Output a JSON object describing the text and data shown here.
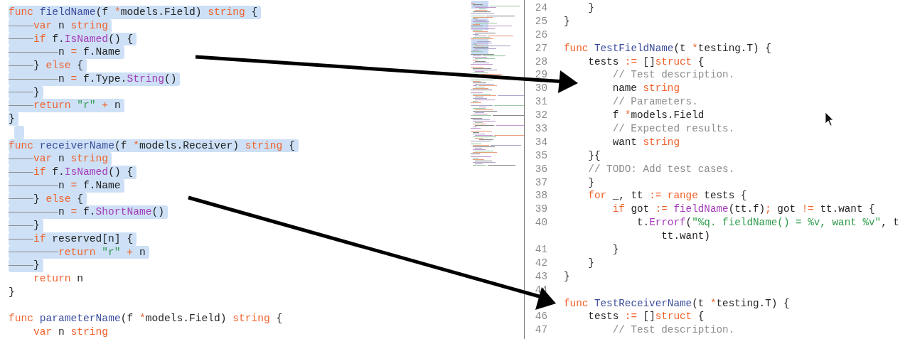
{
  "left_editor": {
    "lines": [
      {
        "selected": true,
        "tokens": [
          {
            "kind": "keyword",
            "text": "func "
          },
          {
            "kind": "decl",
            "text": "fieldName"
          },
          {
            "kind": "plain",
            "text": "(f "
          },
          {
            "kind": "keyword",
            "text": "*"
          },
          {
            "kind": "plain",
            "text": "models.Field) "
          },
          {
            "kind": "keyword",
            "text": "string"
          },
          {
            "kind": "plain",
            "text": " {"
          }
        ]
      },
      {
        "selected": true,
        "tokens": [
          {
            "kind": "keyword",
            "text": "\tvar"
          },
          {
            "kind": "plain",
            "text": " n "
          },
          {
            "kind": "keyword",
            "text": "string"
          }
        ]
      },
      {
        "selected": true,
        "tokens": [
          {
            "kind": "keyword",
            "text": "\tif"
          },
          {
            "kind": "plain",
            "text": " f."
          },
          {
            "kind": "call",
            "text": "IsNamed"
          },
          {
            "kind": "plain",
            "text": "() {"
          }
        ]
      },
      {
        "selected": true,
        "tokens": [
          {
            "kind": "plain",
            "text": "\t\tn "
          },
          {
            "kind": "keyword",
            "text": "="
          },
          {
            "kind": "plain",
            "text": " f.Name"
          }
        ]
      },
      {
        "selected": true,
        "tokens": [
          {
            "kind": "plain",
            "text": "\t} "
          },
          {
            "kind": "keyword",
            "text": "else"
          },
          {
            "kind": "plain",
            "text": " {"
          }
        ]
      },
      {
        "selected": true,
        "tokens": [
          {
            "kind": "plain",
            "text": "\t\tn "
          },
          {
            "kind": "keyword",
            "text": "="
          },
          {
            "kind": "plain",
            "text": " f.Type."
          },
          {
            "kind": "call",
            "text": "String"
          },
          {
            "kind": "plain",
            "text": "()"
          }
        ]
      },
      {
        "selected": true,
        "tokens": [
          {
            "kind": "plain",
            "text": "\t}"
          }
        ]
      },
      {
        "selected": true,
        "tokens": [
          {
            "kind": "keyword",
            "text": "\treturn"
          },
          {
            "kind": "string",
            "text": " \"r\""
          },
          {
            "kind": "keyword",
            "text": " + "
          },
          {
            "kind": "plain",
            "text": "n"
          }
        ]
      },
      {
        "selected": true,
        "tokens": [
          {
            "kind": "plain",
            "text": "}"
          }
        ]
      },
      {
        "selected": true
      },
      {
        "selected": true,
        "tokens": [
          {
            "kind": "keyword",
            "text": "func "
          },
          {
            "kind": "decl",
            "text": "receiverName"
          },
          {
            "kind": "plain",
            "text": "(f "
          },
          {
            "kind": "keyword",
            "text": "*"
          },
          {
            "kind": "plain",
            "text": "models.Receiver) "
          },
          {
            "kind": "keyword",
            "text": "string"
          },
          {
            "kind": "plain",
            "text": " {"
          }
        ]
      },
      {
        "selected": true,
        "tokens": [
          {
            "kind": "keyword",
            "text": "\tvar"
          },
          {
            "kind": "plain",
            "text": " n "
          },
          {
            "kind": "keyword",
            "text": "string"
          }
        ]
      },
      {
        "selected": true,
        "tokens": [
          {
            "kind": "keyword",
            "text": "\tif"
          },
          {
            "kind": "plain",
            "text": " f."
          },
          {
            "kind": "call",
            "text": "IsNamed"
          },
          {
            "kind": "plain",
            "text": "() {"
          }
        ]
      },
      {
        "selected": true,
        "tokens": [
          {
            "kind": "plain",
            "text": "\t\tn "
          },
          {
            "kind": "keyword",
            "text": "="
          },
          {
            "kind": "plain",
            "text": " f.Name"
          }
        ]
      },
      {
        "selected": true,
        "tokens": [
          {
            "kind": "plain",
            "text": "\t} "
          },
          {
            "kind": "keyword",
            "text": "else"
          },
          {
            "kind": "plain",
            "text": " {"
          }
        ]
      },
      {
        "selected": true,
        "tokens": [
          {
            "kind": "plain",
            "text": "\t\tn "
          },
          {
            "kind": "keyword",
            "text": "="
          },
          {
            "kind": "plain",
            "text": " f."
          },
          {
            "kind": "call",
            "text": "ShortName"
          },
          {
            "kind": "plain",
            "text": "()"
          }
        ]
      },
      {
        "selected": true,
        "tokens": [
          {
            "kind": "plain",
            "text": "\t}"
          }
        ]
      },
      {
        "selected": true,
        "tokens": [
          {
            "kind": "keyword",
            "text": "\tif"
          },
          {
            "kind": "plain",
            "text": " reserved[n] {"
          }
        ]
      },
      {
        "selected": true,
        "tokens": [
          {
            "kind": "keyword",
            "text": "\t\treturn"
          },
          {
            "kind": "string",
            "text": " \"r\""
          },
          {
            "kind": "keyword",
            "text": " + "
          },
          {
            "kind": "plain",
            "text": "n"
          }
        ]
      },
      {
        "selected": true,
        "tokens": [
          {
            "kind": "plain",
            "text": "\t}"
          }
        ]
      },
      {
        "selected": false,
        "tokens": [
          {
            "kind": "keyword",
            "text": "\treturn"
          },
          {
            "kind": "plain",
            "text": " n"
          }
        ]
      },
      {
        "selected": false,
        "tokens": [
          {
            "kind": "plain",
            "text": "}"
          }
        ]
      },
      {
        "selected": false
      },
      {
        "selected": false,
        "tokens": [
          {
            "kind": "keyword",
            "text": "func "
          },
          {
            "kind": "decl",
            "text": "parameterName"
          },
          {
            "kind": "plain",
            "text": "(f "
          },
          {
            "kind": "keyword",
            "text": "*"
          },
          {
            "kind": "plain",
            "text": "models.Field) "
          },
          {
            "kind": "keyword",
            "text": "string"
          },
          {
            "kind": "plain",
            "text": " {"
          }
        ]
      },
      {
        "selected": false,
        "tokens": [
          {
            "kind": "keyword",
            "text": "\tvar"
          },
          {
            "kind": "plain",
            "text": " n "
          },
          {
            "kind": "keyword",
            "text": "string"
          }
        ]
      }
    ]
  },
  "right_editor": {
    "lines": [
      {
        "number": "24",
        "tokens": [
          {
            "kind": "plain",
            "text": "\t}"
          }
        ]
      },
      {
        "number": "25",
        "tokens": [
          {
            "kind": "plain",
            "text": "}"
          }
        ]
      },
      {
        "number": "26"
      },
      {
        "number": "27",
        "tokens": [
          {
            "kind": "keyword",
            "text": "func "
          },
          {
            "kind": "decl",
            "text": "TestFieldName"
          },
          {
            "kind": "plain",
            "text": "(t "
          },
          {
            "kind": "keyword",
            "text": "*"
          },
          {
            "kind": "plain",
            "text": "testing.T) {"
          }
        ]
      },
      {
        "number": "28",
        "tokens": [
          {
            "kind": "plain",
            "text": "\ttests "
          },
          {
            "kind": "keyword",
            "text": ":="
          },
          {
            "kind": "plain",
            "text": " []"
          },
          {
            "kind": "keyword",
            "text": "struct"
          },
          {
            "kind": "plain",
            "text": " {"
          }
        ]
      },
      {
        "number": "29",
        "tokens": [
          {
            "kind": "comment",
            "text": "\t\t// Test description."
          }
        ]
      },
      {
        "number": "30",
        "tokens": [
          {
            "kind": "plain",
            "text": "\t\tname "
          },
          {
            "kind": "keyword",
            "text": "string"
          }
        ]
      },
      {
        "number": "31",
        "tokens": [
          {
            "kind": "comment",
            "text": "\t\t// Parameters."
          }
        ]
      },
      {
        "number": "32",
        "tokens": [
          {
            "kind": "plain",
            "text": "\t\tf "
          },
          {
            "kind": "keyword",
            "text": "*"
          },
          {
            "kind": "plain",
            "text": "models.Field"
          }
        ]
      },
      {
        "number": "33",
        "tokens": [
          {
            "kind": "comment",
            "text": "\t\t// Expected results."
          }
        ]
      },
      {
        "number": "34",
        "tokens": [
          {
            "kind": "plain",
            "text": "\t\twant "
          },
          {
            "kind": "keyword",
            "text": "string"
          }
        ]
      },
      {
        "number": "35",
        "tokens": [
          {
            "kind": "plain",
            "text": "\t}{"
          }
        ]
      },
      {
        "number": "36",
        "tokens": [
          {
            "kind": "comment",
            "text": "\t// TODO: Add test cases."
          }
        ]
      },
      {
        "number": "37",
        "tokens": [
          {
            "kind": "plain",
            "text": "\t}"
          }
        ]
      },
      {
        "number": "38",
        "tokens": [
          {
            "kind": "keyword",
            "text": "\tfor"
          },
          {
            "kind": "plain",
            "text": " _, tt "
          },
          {
            "kind": "keyword",
            "text": ":= range"
          },
          {
            "kind": "plain",
            "text": " tests {"
          }
        ]
      },
      {
        "number": "39",
        "tokens": [
          {
            "kind": "keyword",
            "text": "\t\tif"
          },
          {
            "kind": "plain",
            "text": " got "
          },
          {
            "kind": "keyword",
            "text": ":= "
          },
          {
            "kind": "call",
            "text": "fieldName"
          },
          {
            "kind": "plain",
            "text": "(tt.f)"
          },
          {
            "kind": "keyword",
            "text": ";"
          },
          {
            "kind": "plain",
            "text": " got "
          },
          {
            "kind": "keyword",
            "text": "!="
          },
          {
            "kind": "plain",
            "text": " tt.want {"
          }
        ]
      },
      {
        "number": "40",
        "tokens": [
          {
            "kind": "plain",
            "text": "\t\t\tt."
          },
          {
            "kind": "call",
            "text": "Errorf"
          },
          {
            "kind": "plain",
            "text": "("
          },
          {
            "kind": "string",
            "text": "\"%q. fieldName() = %v, want %v\""
          },
          {
            "kind": "plain",
            "text": ", t"
          }
        ],
        "continuation": [
          {
            "kind": "plain",
            "text": "\t\t\t\ttt.want)"
          }
        ]
      },
      {
        "number": "41",
        "tokens": [
          {
            "kind": "plain",
            "text": "\t\t}"
          }
        ]
      },
      {
        "number": "42",
        "tokens": [
          {
            "kind": "plain",
            "text": "\t}"
          }
        ]
      },
      {
        "number": "43",
        "tokens": [
          {
            "kind": "plain",
            "text": "}"
          }
        ]
      },
      {
        "number": "44"
      },
      {
        "tokens": [
          {
            "kind": "keyword",
            "text": "func "
          },
          {
            "kind": "decl",
            "text": "TestReceiverName"
          },
          {
            "kind": "plain",
            "text": "(t "
          },
          {
            "kind": "keyword",
            "text": "*"
          },
          {
            "kind": "plain",
            "text": "testing.T) {"
          }
        ]
      },
      {
        "number": "46",
        "tokens": [
          {
            "kind": "plain",
            "text": "\ttests "
          },
          {
            "kind": "keyword",
            "text": ":="
          },
          {
            "kind": "plain",
            "text": " []"
          },
          {
            "kind": "keyword",
            "text": "struct"
          },
          {
            "kind": "plain",
            "text": " {"
          }
        ]
      },
      {
        "number": "47",
        "tokens": [
          {
            "kind": "comment",
            "text": "\t\t// Test description."
          }
        ]
      }
    ]
  }
}
